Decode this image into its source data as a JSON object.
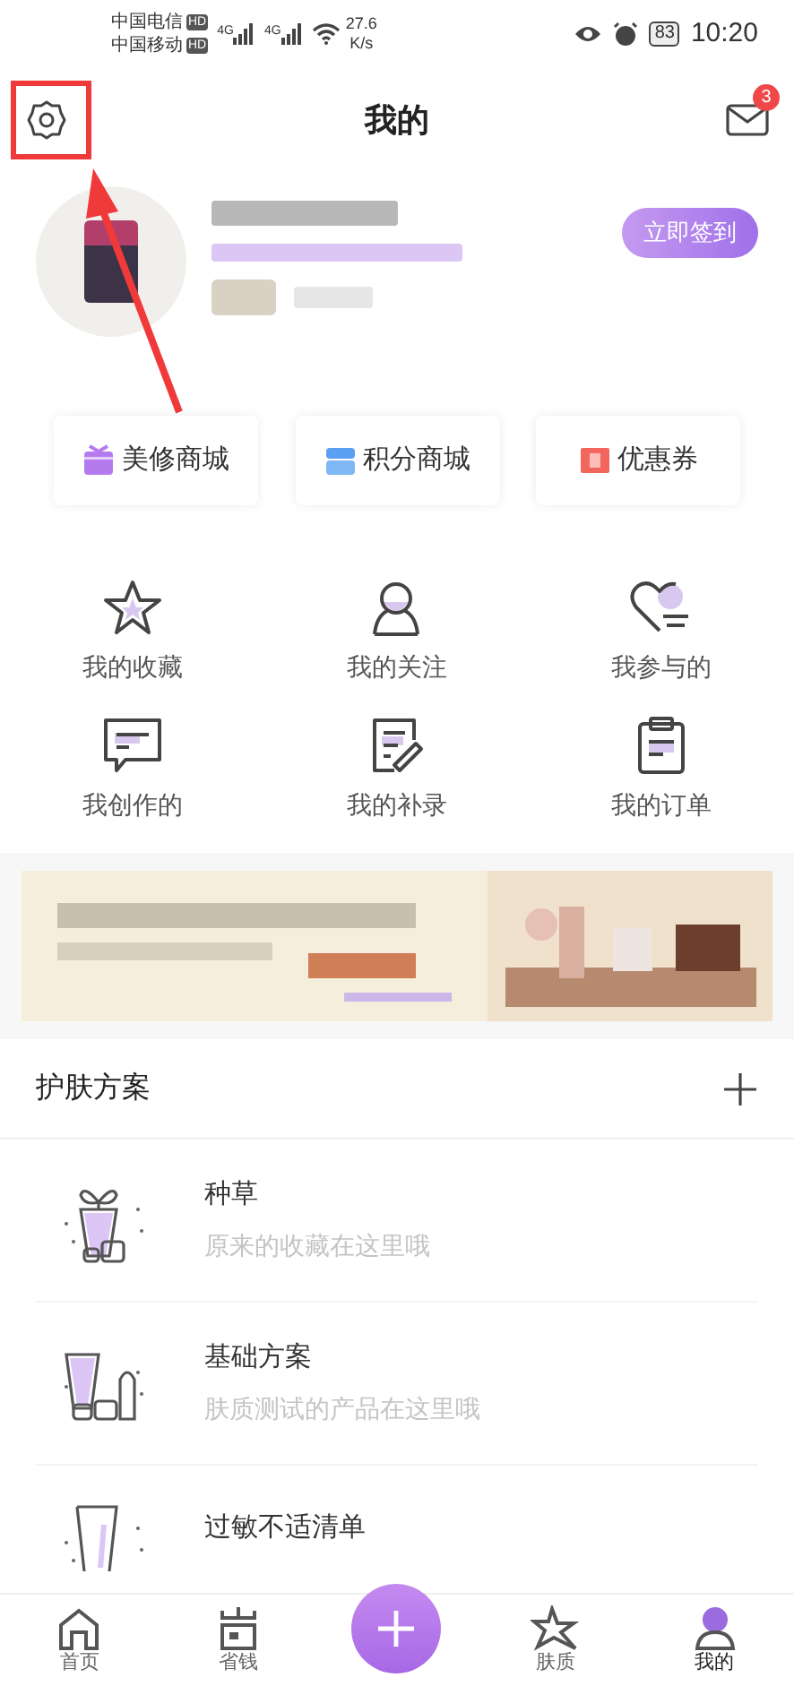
{
  "status_bar": {
    "carriers": [
      {
        "name": "中国电信",
        "badge": "HD"
      },
      {
        "name": "中国移动",
        "badge": "HD"
      }
    ],
    "network": [
      "4G",
      "4G"
    ],
    "speed": "27.6",
    "speed_unit": "K/s",
    "battery": "83",
    "time": "10:20"
  },
  "header": {
    "title": "我的",
    "unread_count": "3"
  },
  "profile": {
    "checkin_button": "立即签到"
  },
  "shortcuts": [
    {
      "kind": "gift",
      "label": "美修商城"
    },
    {
      "kind": "store",
      "label": "积分商城"
    },
    {
      "kind": "coupon",
      "label": "优惠券"
    }
  ],
  "grid": [
    {
      "kind": "star",
      "label": "我的收藏"
    },
    {
      "kind": "person",
      "label": "我的关注"
    },
    {
      "kind": "heart",
      "label": "我参与的"
    },
    {
      "kind": "chat",
      "label": "我创作的"
    },
    {
      "kind": "edit",
      "label": "我的补录"
    },
    {
      "kind": "clipboard",
      "label": "我的订单"
    }
  ],
  "skincare": {
    "title": "护肤方案",
    "items": [
      {
        "kind": "plant",
        "title": "种草",
        "subtitle": "原来的收藏在这里哦"
      },
      {
        "kind": "bottles",
        "title": "基础方案",
        "subtitle": "肤质测试的产品在这里哦"
      },
      {
        "kind": "cup",
        "title": "过敏不适清单"
      }
    ]
  },
  "tab_bar": [
    {
      "kind": "home",
      "label": "首页",
      "selected": false
    },
    {
      "kind": "wallet",
      "label": "省钱",
      "selected": false
    },
    {
      "kind": "add"
    },
    {
      "kind": "sparkle",
      "label": "肤质",
      "selected": false
    },
    {
      "kind": "me",
      "label": "我的",
      "selected": true
    }
  ]
}
